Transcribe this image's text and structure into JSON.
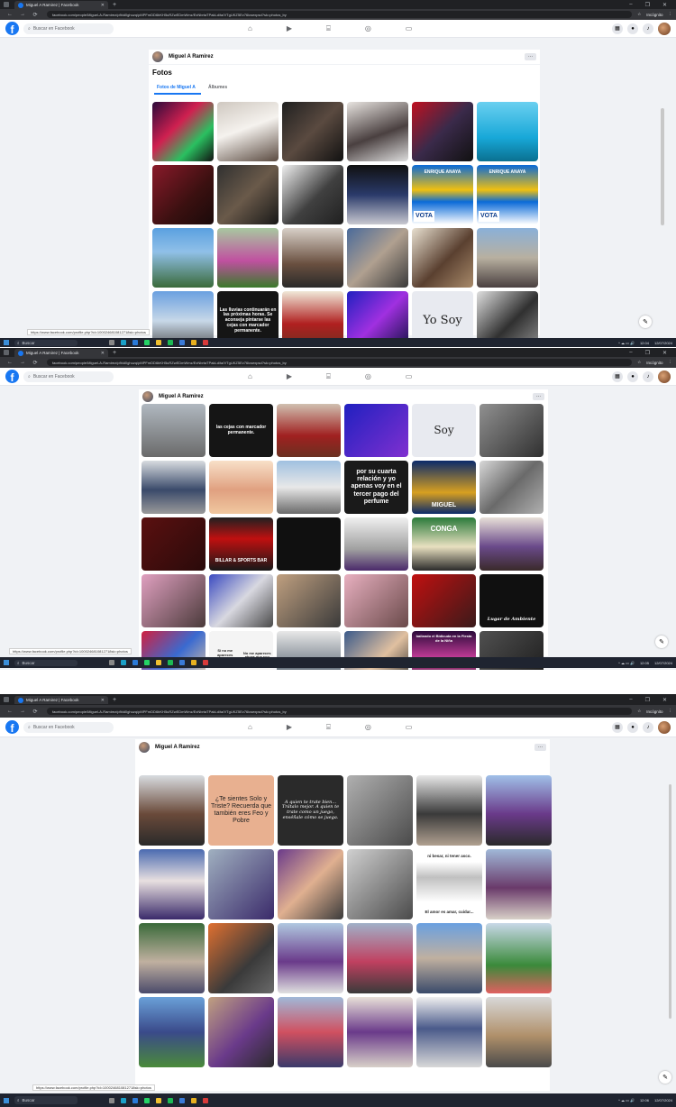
{
  "browser": {
    "tab_title": "Miguel A Ramirez | Facebook",
    "new_tab": "+",
    "url": "facebook.com/people/Miguel-A-Ramirez/pfbid0ghuzq/pMPFmDD6bKH5uRZwEDmWmz/ExNbrtaTPakLd/ta/VTgUKZ5Ev76icsexpsd?sk=photos_by",
    "incognito_label": "Incógnito"
  },
  "facebook": {
    "search_placeholder": "Buscar en Facebook",
    "profile_name": "Miguel A Ramirez",
    "more_label": "···"
  },
  "photos": {
    "heading": "Fotos",
    "tab_photos_of": "Fotos de Miguel A",
    "tab_albums": "Álbumes"
  },
  "thumb_text": {
    "vota1": "VOTA",
    "vota2": "VOTA",
    "enrique1": "ENRIQUE ANAYA",
    "enrique2": "ENRIQUE ANAYA",
    "lluvias": "Las lluvias continuarán en las próximas horas. Se aconseja pintarse las cejas con marcador permanente.",
    "cejas": "las cejas con marcador permanente.",
    "yosoy": "Yo Soy",
    "soy": "Soy",
    "cuarta": "por su cuarta relación y yo apenas voy en el tercer pago del perfume",
    "miguel": "MIGUEL",
    "billar": "BILLAR & SPORTS BAR",
    "conga": "CONGA",
    "lugar": "Lugar de Ambiente",
    "carlos": "Si no me apareces cuando era Carlos",
    "charly": "No me apareces ahora que soy Charly",
    "bailando": "bailando el Bidicuda en la Fiesta de la Niña",
    "sientes": "¿Te sientes Solo y Triste? Recuerda que también eres Feo y Pobre",
    "quien": "A quien te trate bien... Trátalo mejor. A quien te trate como un juego, enséñale cómo se juega.",
    "besar": "ni besar, ni tener asco.",
    "amor": "El amor es amar, cuidar..."
  },
  "taskbar": {
    "search_label": "Buscar",
    "time1": "12:04",
    "time2": "12:05",
    "time3": "12:06",
    "date": "12/07/2024"
  },
  "status_urls": {
    "s1": "https://www.facebook.com/profile.php?id=1000246810812718sk=photos",
    "s2": "https://www.facebook.com/profile.php?id=1000246810812718sk=photos",
    "s3": "https://www.facebook.com/profile.php?id=1000246810812718sk=photos"
  }
}
